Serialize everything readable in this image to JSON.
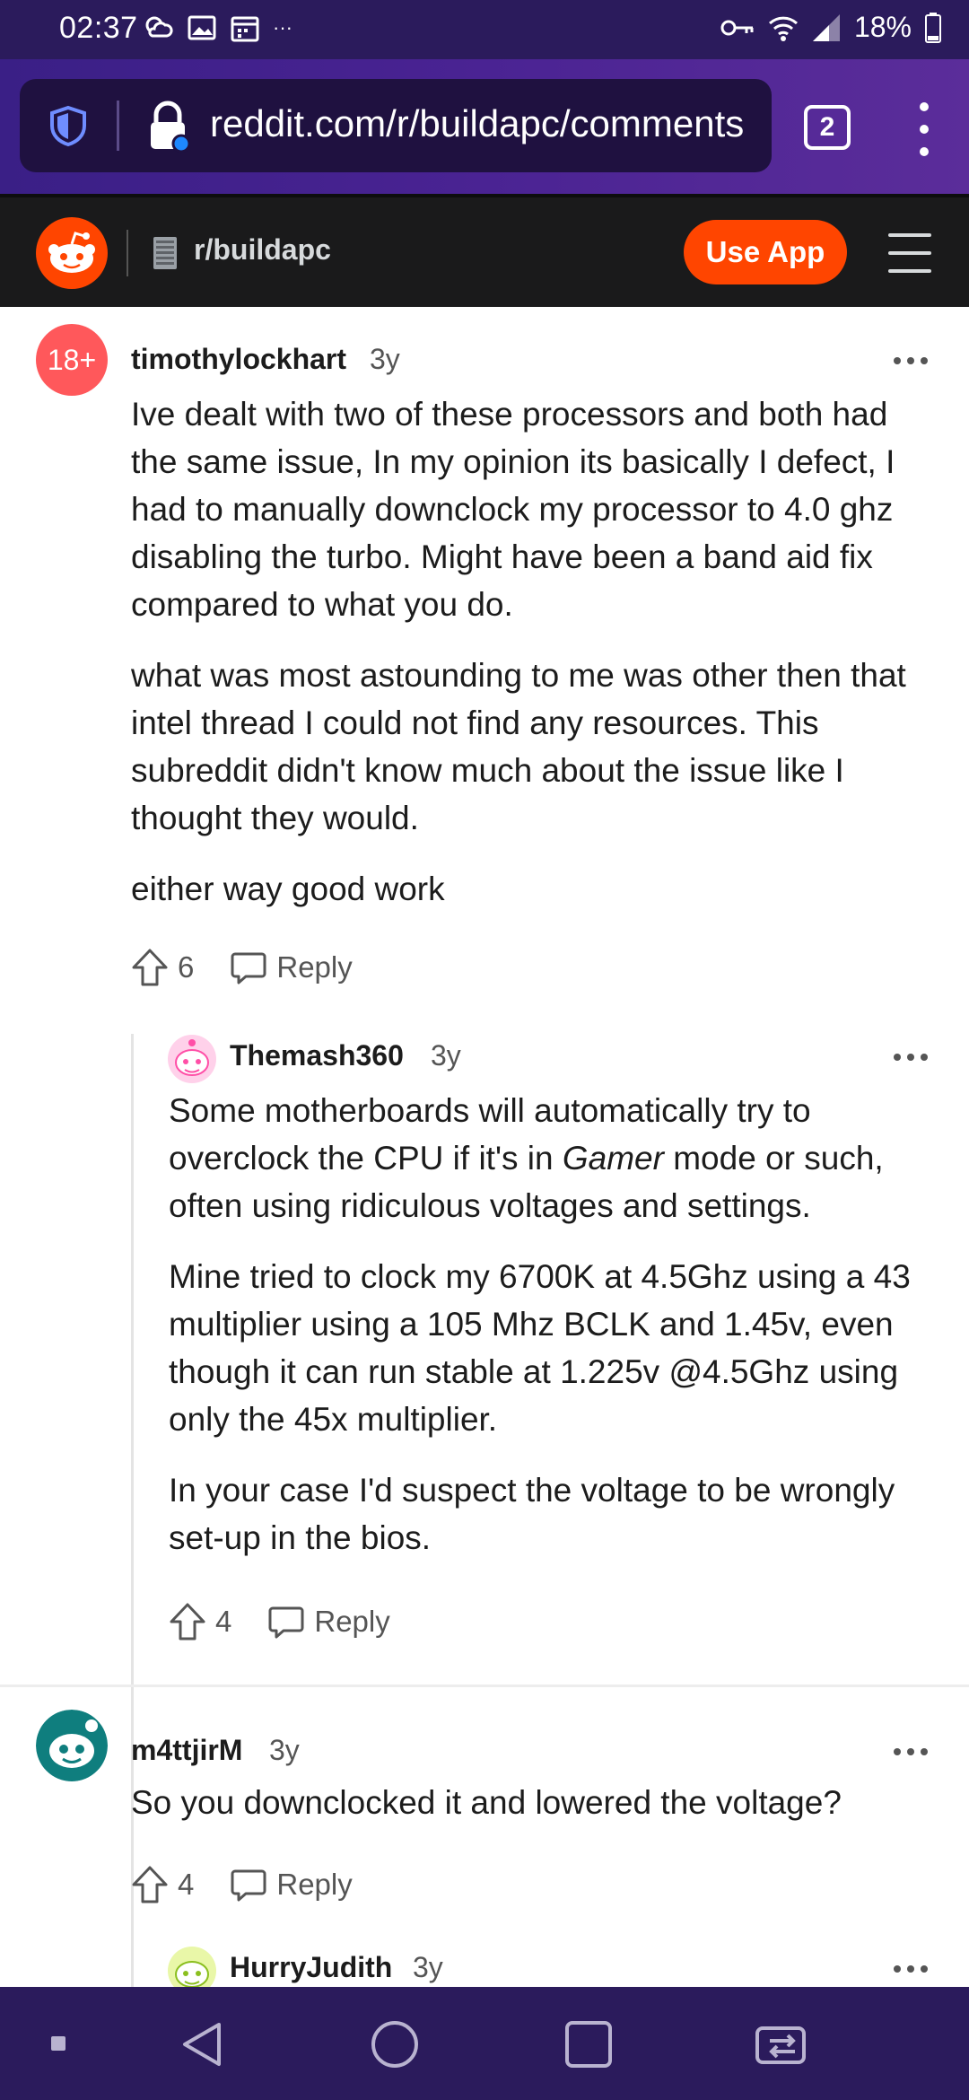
{
  "status_bar": {
    "time": "02:37",
    "overflow": "···",
    "battery": "18%"
  },
  "browser": {
    "url": "reddit.com/r/buildapc/comments",
    "tab_count": "2"
  },
  "reddit_header": {
    "subreddit": "r/buildapc",
    "use_app_label": "Use App"
  },
  "comments": [
    {
      "avatar_text": "18+",
      "username": "timothylockhart",
      "age": "3y",
      "paragraphs": [
        "Ive dealt with two of these processors and both had the same issue, In my opinion its basically I defect, I had to manually downclock my processor to 4.0 ghz disabling the turbo. Might have been a band aid fix compared to what you do.",
        "what was most astounding to me was other then that intel thread I could not find any resources. This subreddit didn't know much about the issue like I thought they would.",
        "either way good work"
      ],
      "votes": "6",
      "reply_label": "Reply"
    },
    {
      "username": "Themash360",
      "age": "3y",
      "p1_before": "Some motherboards will automatically try to overclock the CPU if it's in ",
      "p1_em": "Gamer",
      "p1_after": " mode or such, often using ridiculous voltages and settings.",
      "p2": "Mine tried to clock my 6700K at 4.5Ghz using a 43 multiplier using a 105 Mhz BCLK and 1.45v, even though it can run stable at 1.225v @4.5Ghz using only the 45x multiplier.",
      "p3": "In your case I'd suspect the voltage to be wrongly set-up in the bios.",
      "votes": "4",
      "reply_label": "Reply"
    },
    {
      "username": "m4ttjirM",
      "age": "3y",
      "text": "So you downclocked it and lowered the voltage?",
      "votes": "4",
      "reply_label": "Reply"
    },
    {
      "username": "HurryJudith",
      "age": "3y"
    }
  ],
  "colors": {
    "status_bg": "#2b1b5c",
    "reddit_orange": "#ff4500",
    "header_bg": "#1a1a1b",
    "nsfw_red": "#ff585b"
  }
}
